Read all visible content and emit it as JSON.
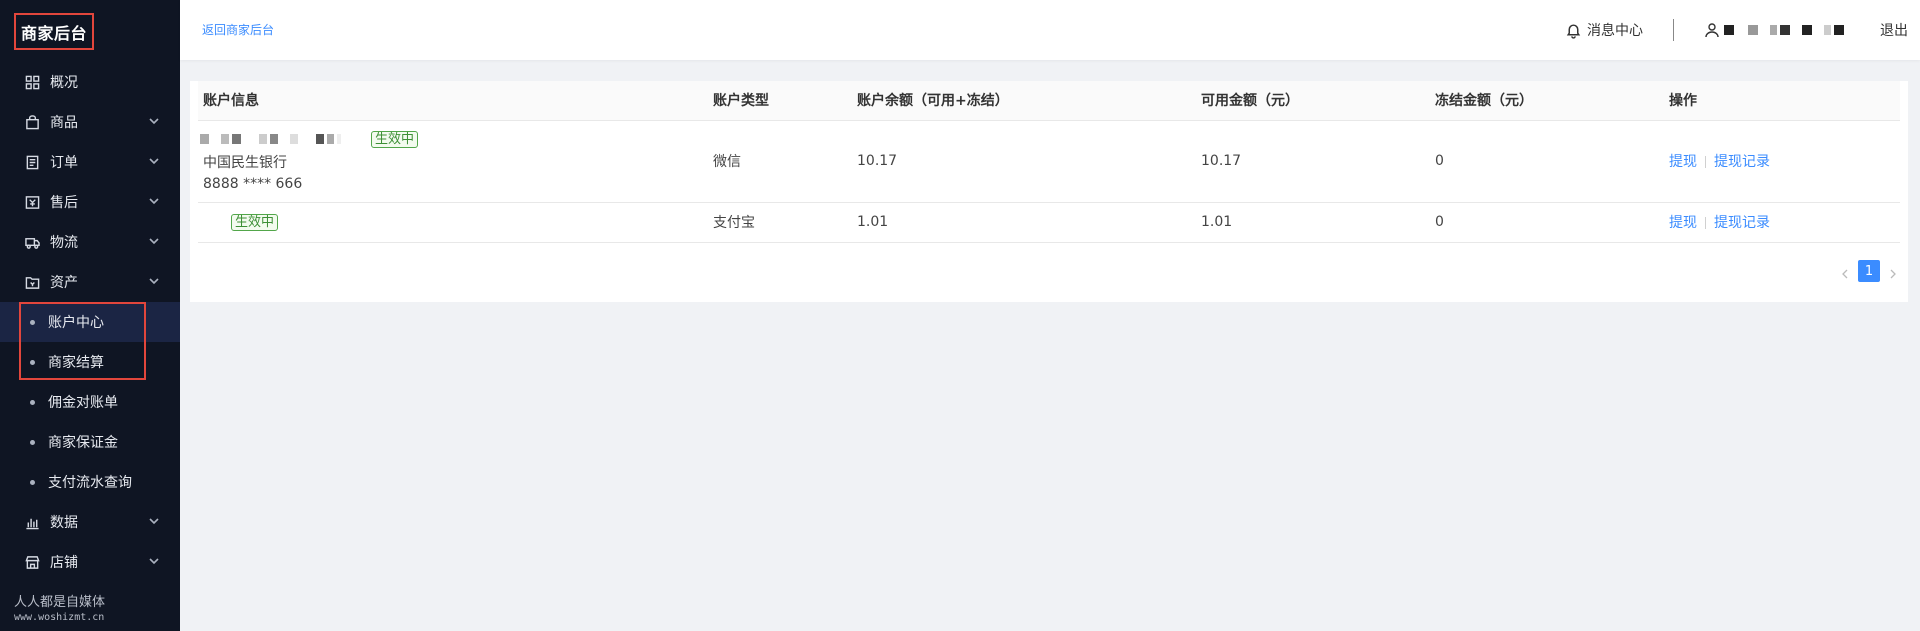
{
  "sidebar": {
    "brand": "商家后台",
    "menu": [
      {
        "label": "概况",
        "icon": "dashboard-icon",
        "expandable": false
      },
      {
        "label": "商品",
        "icon": "bag-icon",
        "expandable": true
      },
      {
        "label": "订单",
        "icon": "order-icon",
        "expandable": true
      },
      {
        "label": "售后",
        "icon": "aftersale-icon",
        "expandable": true
      },
      {
        "label": "物流",
        "icon": "truck-icon",
        "expandable": true
      },
      {
        "label": "资产",
        "icon": "wallet-icon",
        "expandable": true
      }
    ],
    "asset_sub": [
      {
        "label": "账户中心",
        "active": true
      },
      {
        "label": "商家结算",
        "active": false
      },
      {
        "label": "佣金对账单",
        "active": false
      },
      {
        "label": "商家保证金",
        "active": false
      },
      {
        "label": "支付流水查询",
        "active": false
      }
    ],
    "menu_after": [
      {
        "label": "数据",
        "icon": "chart-icon",
        "expandable": true
      },
      {
        "label": "店铺",
        "icon": "store-icon",
        "expandable": true
      }
    ],
    "watermark_line1": "人人都是自媒体",
    "watermark_line2": "www.woshizmt.cn"
  },
  "header": {
    "back_link": "返回商家后台",
    "message_center": "消息中心",
    "logout": "退出"
  },
  "table": {
    "columns": [
      "账户信息",
      "账户类型",
      "账户余额（可用+冻结）",
      "可用金额（元）",
      "冻结金额（元）",
      "操作"
    ],
    "rows": [
      {
        "status": "生效中",
        "bank": "中国民生银行",
        "account_no": "8888 **** 666",
        "type": "微信",
        "balance": "10.17",
        "available": "10.17",
        "frozen": "0",
        "op_withdraw": "提现",
        "op_records": "提现记录"
      },
      {
        "status": "生效中",
        "type": "支付宝",
        "balance": "1.01",
        "available": "1.01",
        "frozen": "0",
        "op_withdraw": "提现",
        "op_records": "提现记录"
      }
    ]
  },
  "pagination": {
    "current": "1"
  },
  "colors": {
    "accent": "#3b8cff",
    "sidebar_bg": "#0f1523",
    "highlight_box": "#e2463c",
    "status_green": "#52a64a"
  }
}
